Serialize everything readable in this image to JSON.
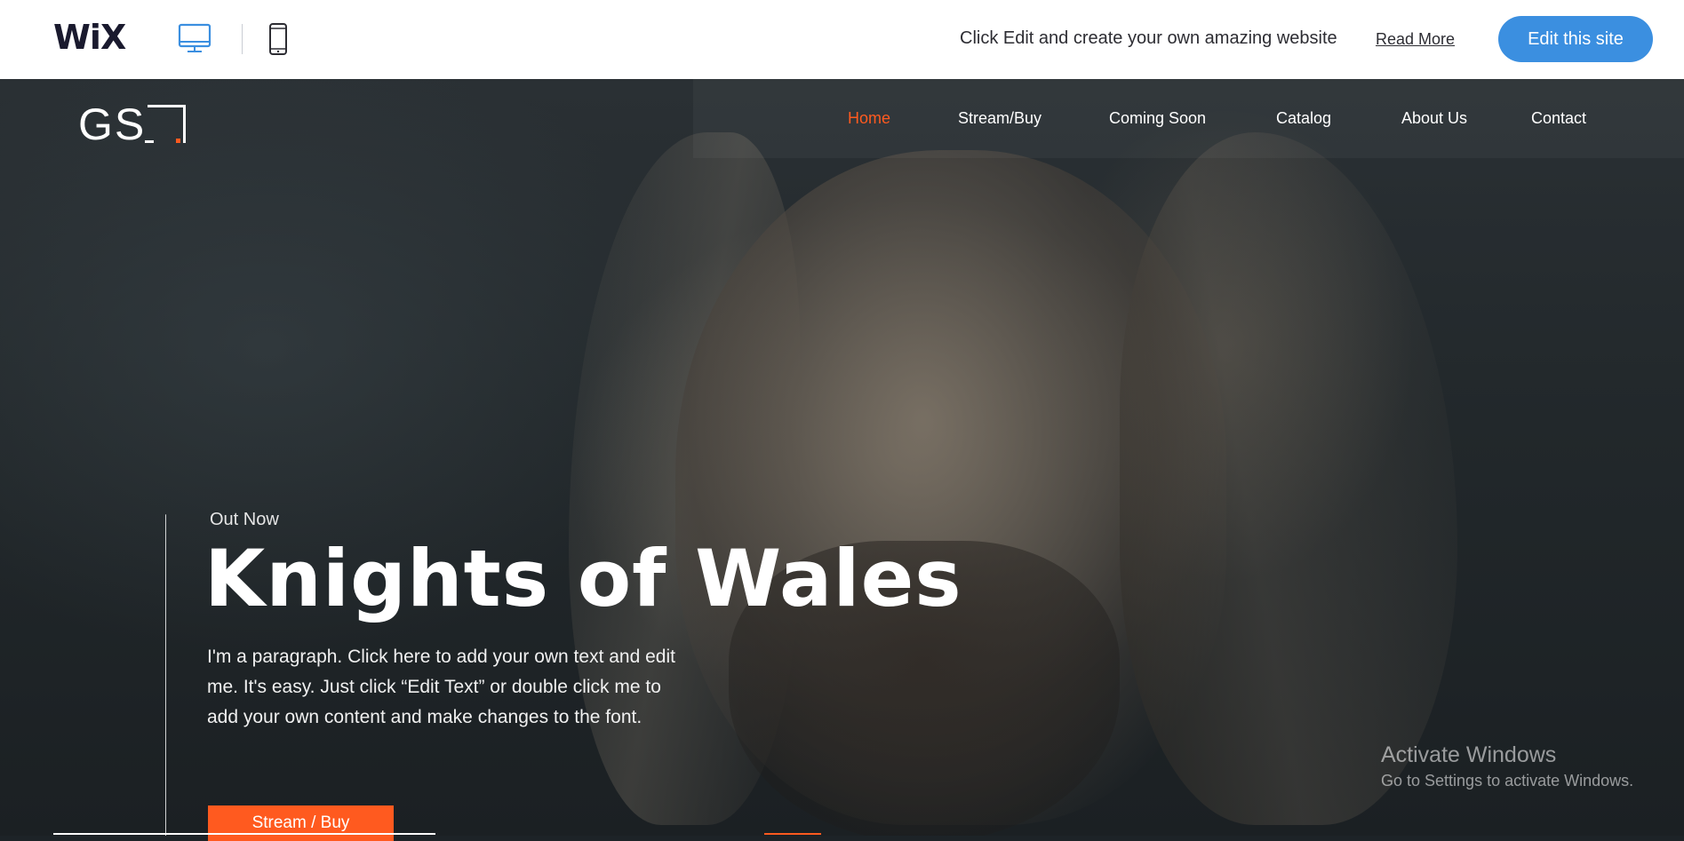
{
  "wix_bar": {
    "logo": "WiX",
    "desktop_icon": "desktop-monitor-icon",
    "mobile_icon": "mobile-phone-icon",
    "message": "Click Edit and create your own amazing website",
    "read_more": "Read More",
    "edit_button": "Edit this site"
  },
  "site": {
    "logo_text": "GS",
    "nav": [
      {
        "label": "Home",
        "active": true
      },
      {
        "label": "Stream/Buy",
        "active": false
      },
      {
        "label": "Coming Soon",
        "active": false
      },
      {
        "label": "Catalog",
        "active": false
      },
      {
        "label": "About Us",
        "active": false
      },
      {
        "label": "Contact",
        "active": false
      }
    ],
    "colors": {
      "accent": "#ff5a1f",
      "wix_blue": "#3b8fe0"
    }
  },
  "hero": {
    "eyebrow": "Out Now",
    "title": "Knights of Wales",
    "paragraph": "I'm a paragraph. Click here to add your own text and edit me. It's easy. Just click “Edit Text” or double click me to add your own content and make changes to the font.",
    "cta": "Stream / Buy"
  },
  "os_overlay": {
    "line1": "Activate Windows",
    "line2": "Go to Settings to activate Windows."
  }
}
